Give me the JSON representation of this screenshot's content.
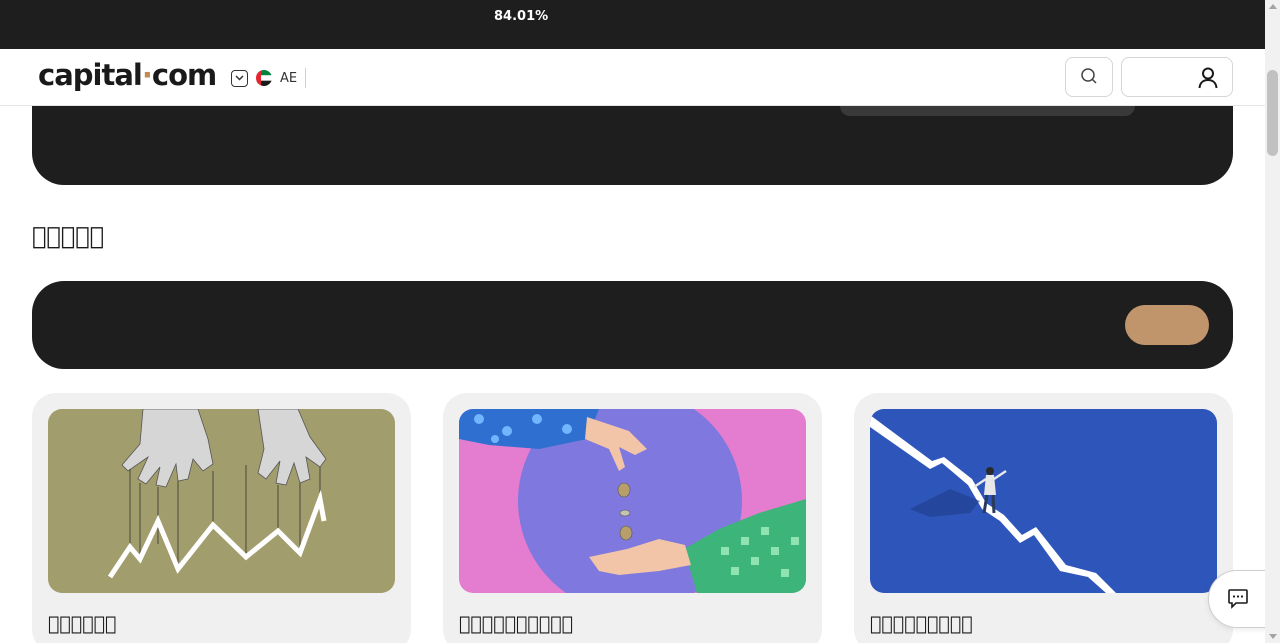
{
  "banner": {
    "percent": "84.01%"
  },
  "header": {
    "logo_left": "capital",
    "logo_dot": "·",
    "logo_right": "com",
    "region_code": "AE"
  },
  "section": {
    "title": "􏰀􏰀􏰀􏰀􏰀"
  },
  "cards": [
    {
      "title": "􏰀􏰀􏰀􏰀􏰀􏰀",
      "image": "puppet-hands-chart"
    },
    {
      "title": "􏰀􏰀􏰀􏰀􏰀􏰀􏰀􏰀􏰀􏰀",
      "image": "coins-dropping-hands"
    },
    {
      "title": "􏰀􏰀􏰀􏰀􏰀􏰀􏰀􏰀􏰀",
      "image": "man-walking-falling-chart"
    }
  ],
  "colors": {
    "dark": "#1e1e1e",
    "accent": "#c1956b",
    "card_bg": "#f0f0f0"
  },
  "icons": [
    "chevron-down-icon",
    "uae-flag-icon",
    "search-icon",
    "user-icon",
    "chat-icon"
  ]
}
